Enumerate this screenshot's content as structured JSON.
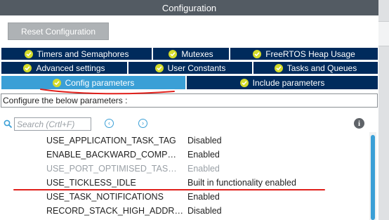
{
  "window": {
    "title": "Configuration"
  },
  "toolbar": {
    "reset_label": "Reset Configuration"
  },
  "tabs_row1": [
    {
      "label": "Timers and Semaphores"
    },
    {
      "label": "Mutexes"
    },
    {
      "label": "FreeRTOS Heap Usage"
    }
  ],
  "tabs_row2": [
    {
      "label": "Advanced settings"
    },
    {
      "label": "User Constants"
    },
    {
      "label": "Tasks and Queues"
    }
  ],
  "tabs_row3": [
    {
      "label": "Config parameters",
      "active": true
    },
    {
      "label": "Include parameters",
      "active": false
    }
  ],
  "description": "Configure the below parameters :",
  "search": {
    "placeholder": "Search (Crtl+F)"
  },
  "params": [
    {
      "name": "USE_APPLICATION_TASK_TAG",
      "value": "Disabled",
      "enabled": true
    },
    {
      "name": "ENABLE_BACKWARD_COMP…",
      "value": "Enabled",
      "enabled": true
    },
    {
      "name": "USE_PORT_OPTIMISED_TAS…",
      "value": "Enabled",
      "enabled": false
    },
    {
      "name": "USE_TICKLESS_IDLE",
      "value": "Built in functionality enabled",
      "enabled": true
    },
    {
      "name": "USE_TASK_NOTIFICATIONS",
      "value": "Enabled",
      "enabled": true
    },
    {
      "name": "RECORD_STACK_HIGH_ADDR…",
      "value": "Disabled",
      "enabled": true
    }
  ],
  "colors": {
    "tab_bg": "#002b5c",
    "tab_active": "#3a9fd6",
    "check": "#d5dc2a",
    "annotation": "#e0201b"
  }
}
